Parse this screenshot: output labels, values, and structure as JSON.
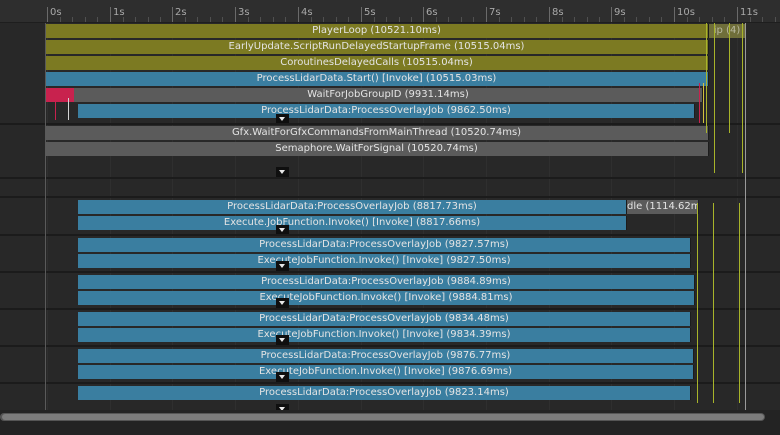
{
  "ruler": {
    "labels": [
      "0s",
      "1s",
      "2s",
      "3s",
      "4s",
      "5s",
      "6s",
      "7s",
      "8s",
      "9s",
      "10s",
      "11s"
    ]
  },
  "colors": {
    "yellow_bar": "#7c7a22",
    "blue_bar": "#3a7ea0",
    "grey_bar": "#5b5b5b",
    "red_marker": "#c8224e",
    "background": "#282828"
  },
  "main_thread": {
    "player_loop": "PlayerLoop (10521.10ms)",
    "player_loop_tail": "ip (4)",
    "early_update": "EarlyUpdate.ScriptRunDelayedStartupFrame (10515.04ms)",
    "coroutines": "CoroutinesDelayedCalls (10515.04ms)",
    "lidar_start": "ProcessLidarData.Start() [Invoke] (10515.03ms)",
    "wait_job": "WaitForJobGroupID (9931.14ms)",
    "overlay_job": "ProcessLidarData:ProcessOverlayJob (9862.50ms)"
  },
  "render_thread": {
    "gfx_wait": "Gfx.WaitForGfxCommandsFromMainThread (10520.74ms)",
    "semaphore": "Semaphore.WaitForSignal (10520.74ms)"
  },
  "workers": [
    {
      "job": "ProcessLidarData:ProcessOverlayJob (8817.73ms)",
      "invoke": "Execute.JobFunction.Invoke() [Invoke] (8817.66ms)",
      "side": "dle (1114.62ms"
    },
    {
      "job": "ProcessLidarData:ProcessOverlayJob (9827.57ms)",
      "invoke": "ExecuteJobFunction.Invoke() [Invoke] (9827.50ms)"
    },
    {
      "job": "ProcessLidarData:ProcessOverlayJob (9884.89ms)",
      "invoke": "ExecuteJobFunction.Invoke() [Invoke] (9884.81ms)"
    },
    {
      "job": "ProcessLidarData:ProcessOverlayJob (9834.48ms)",
      "invoke": "ExecuteJobFunction.Invoke() [Invoke] (9834.39ms)"
    },
    {
      "job": "ProcessLidarData:ProcessOverlayJob (9876.77ms)",
      "invoke": "ExecuteJobFunction.Invoke() [Invoke] (9876.69ms)"
    },
    {
      "job": "ProcessLidarData:ProcessOverlayJob (9823.14ms)"
    }
  ]
}
